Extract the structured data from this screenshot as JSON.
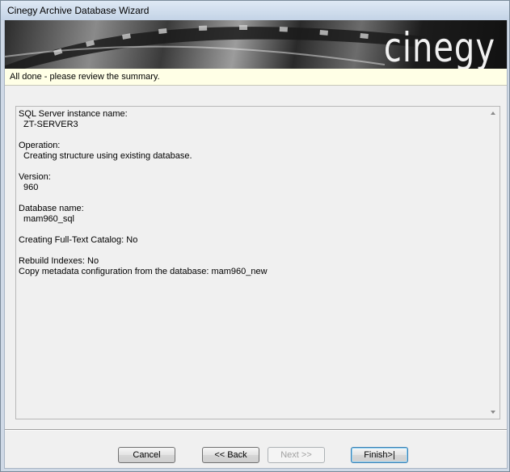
{
  "window": {
    "title": "Cinegy Archive Database Wizard"
  },
  "banner": {
    "logo": "cinegy"
  },
  "header": {
    "status": "All done - please review the summary."
  },
  "summary": {
    "sections": [
      {
        "label": "SQL Server instance name:",
        "value": "ZT-SERVER3"
      },
      {
        "label": "Operation:",
        "value": "Creating structure using existing database."
      },
      {
        "label": "Version:",
        "value": "960"
      },
      {
        "label": "Database name:",
        "value": "mam960_sql"
      },
      {
        "line": "Creating Full-Text Catalog: No"
      },
      {
        "line": "Rebuild Indexes: No"
      },
      {
        "line": "Copy metadata configuration from the database: mam960_new"
      }
    ]
  },
  "buttons": {
    "cancel": "Cancel",
    "back": "<< Back",
    "next": "Next >>",
    "finish": "Finish>|"
  }
}
